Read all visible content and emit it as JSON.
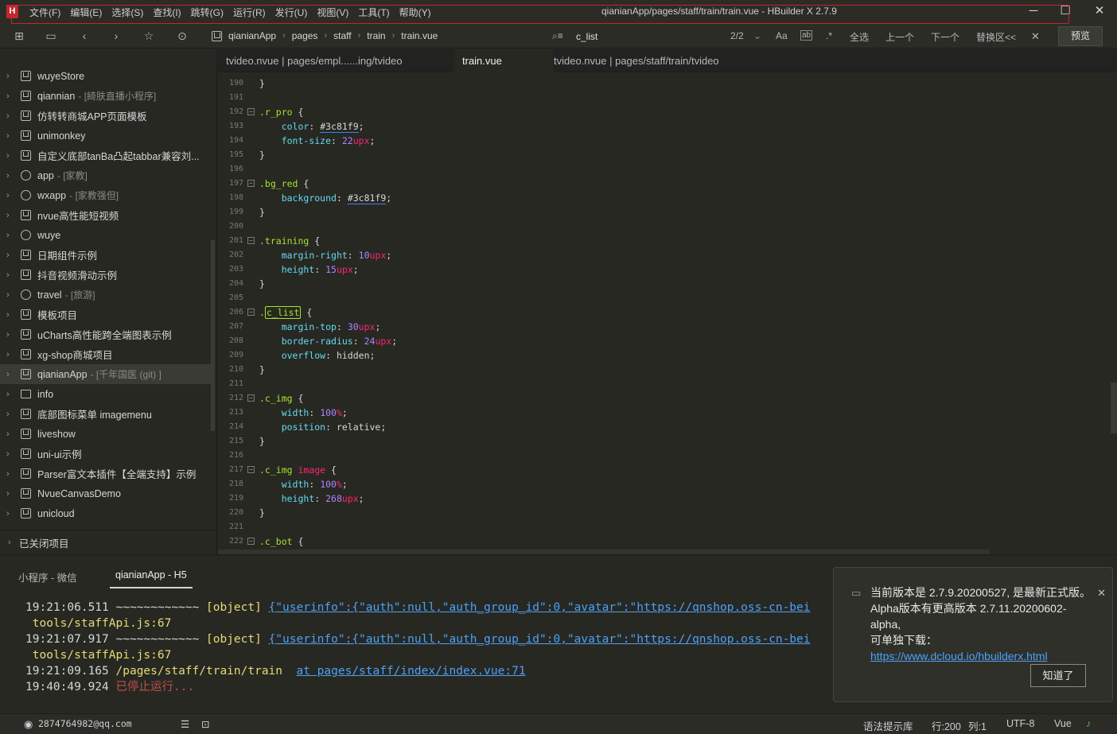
{
  "title_bar": {
    "logo": "H",
    "menus": [
      "文件(F)",
      "编辑(E)",
      "选择(S)",
      "查找(I)",
      "跳转(G)",
      "运行(R)",
      "发行(U)",
      "视图(V)",
      "工具(T)",
      "帮助(Y)"
    ],
    "window_title": "qianianApp/pages/staff/train/train.vue - HBuilder X 2.7.9"
  },
  "toolbar": {
    "breadcrumb": [
      "qianianApp",
      "pages",
      "staff",
      "train",
      "train.vue"
    ],
    "find_value": "c_list",
    "find_count": "2/2",
    "opt_case": "Aa",
    "opt_word": "ab",
    "opt_regex": ".*",
    "select_all": "全选",
    "prev": "上一个",
    "next": "下一个",
    "replace": "替换区<<",
    "preview": "预览"
  },
  "sidebar": {
    "projects": [
      {
        "name": "wuyeStore",
        "tag": "",
        "icon": "project"
      },
      {
        "name": "qiannian",
        "tag": "- [綺肤直播小程序]",
        "icon": "project"
      },
      {
        "name": "仿转转商城APP页面模板",
        "tag": "",
        "icon": "project"
      },
      {
        "name": "unimonkey",
        "tag": "",
        "icon": "project"
      },
      {
        "name": "自定义底部tanBa凸起tabbar兼容刘...",
        "tag": "",
        "icon": "project"
      },
      {
        "name": "app",
        "tag": "- [家教]",
        "icon": "circle"
      },
      {
        "name": "wxapp",
        "tag": "- [家教强但]",
        "icon": "circle"
      },
      {
        "name": "nvue高性能短视频",
        "tag": "",
        "icon": "project"
      },
      {
        "name": "wuye",
        "tag": "",
        "icon": "circle"
      },
      {
        "name": "日期组件示例",
        "tag": "",
        "icon": "project"
      },
      {
        "name": "抖音视频滑动示例",
        "tag": "",
        "icon": "project"
      },
      {
        "name": "travel",
        "tag": "- [旅游]",
        "icon": "circle"
      },
      {
        "name": "模板项目",
        "tag": "",
        "icon": "project"
      },
      {
        "name": "uCharts高性能跨全端图表示例",
        "tag": "",
        "icon": "project"
      },
      {
        "name": "xg-shop商城项目",
        "tag": "",
        "icon": "project"
      },
      {
        "name": "qianianApp",
        "tag": "- [千年国医 (git) ]",
        "icon": "project"
      },
      {
        "name": "info",
        "tag": "",
        "icon": "folder"
      },
      {
        "name": "底部图标菜单 imagemenu",
        "tag": "",
        "icon": "project"
      },
      {
        "name": "liveshow",
        "tag": "",
        "icon": "project"
      },
      {
        "name": "uni-ui示例",
        "tag": "",
        "icon": "project"
      },
      {
        "name": "Parser富文本插件【全端支持】示例",
        "tag": "",
        "icon": "project"
      },
      {
        "name": "NvueCanvasDemo",
        "tag": "",
        "icon": "project"
      },
      {
        "name": "unicloud",
        "tag": "",
        "icon": "project"
      }
    ],
    "selected_index": 15,
    "closed_projects": "已关闭项目"
  },
  "tabs": [
    {
      "label": "tvideo.nvue | pages/empl......ing/tvideo",
      "active": false
    },
    {
      "label": "train.vue",
      "active": true
    },
    {
      "label": "tvideo.nvue | pages/staff/train/tvideo",
      "active": false
    }
  ],
  "code_lines": [
    {
      "n": "190",
      "fold": false,
      "html": "}"
    },
    {
      "n": "191",
      "fold": false,
      "html": ""
    },
    {
      "n": "192",
      "fold": true,
      "html": "<span class='sel'>.r_pro</span> {"
    },
    {
      "n": "193",
      "fold": false,
      "html": "    <span class='prop'>color</span>: <span class='val hl'>#3c81f9</span>;"
    },
    {
      "n": "194",
      "fold": false,
      "html": "    <span class='prop'>font-size</span>: <span class='num'>22</span><span class='unit'>upx</span>;"
    },
    {
      "n": "195",
      "fold": false,
      "html": "}"
    },
    {
      "n": "196",
      "fold": false,
      "html": ""
    },
    {
      "n": "197",
      "fold": true,
      "html": "<span class='sel'>.bg_red</span> {"
    },
    {
      "n": "198",
      "fold": false,
      "html": "    <span class='prop'>background</span>: <span class='val hl'>#3c81f9</span>;"
    },
    {
      "n": "199",
      "fold": false,
      "html": "}"
    },
    {
      "n": "200",
      "fold": false,
      "html": ""
    },
    {
      "n": "201",
      "fold": true,
      "html": "<span class='sel'>.training</span> {"
    },
    {
      "n": "202",
      "fold": false,
      "html": "    <span class='prop'>margin-right</span>: <span class='num'>10</span><span class='unit'>upx</span>;"
    },
    {
      "n": "203",
      "fold": false,
      "html": "    <span class='prop'>height</span>: <span class='num'>15</span><span class='unit'>upx</span>;"
    },
    {
      "n": "204",
      "fold": false,
      "html": "}"
    },
    {
      "n": "205",
      "fold": false,
      "html": ""
    },
    {
      "n": "206",
      "fold": true,
      "html": "<span class='sel'>.<span class='box'>c_list</span></span> {"
    },
    {
      "n": "207",
      "fold": false,
      "html": "    <span class='prop'>margin-top</span>: <span class='num'>30</span><span class='unit'>upx</span>;"
    },
    {
      "n": "208",
      "fold": false,
      "html": "    <span class='prop'>border-radius</span>: <span class='num'>24</span><span class='unit'>upx</span>;"
    },
    {
      "n": "209",
      "fold": false,
      "html": "    <span class='prop'>overflow</span>: <span class='val'>hidden</span>;"
    },
    {
      "n": "210",
      "fold": false,
      "html": "}"
    },
    {
      "n": "211",
      "fold": false,
      "html": ""
    },
    {
      "n": "212",
      "fold": true,
      "html": "<span class='sel'>.c_img</span> {"
    },
    {
      "n": "213",
      "fold": false,
      "html": "    <span class='prop'>width</span>: <span class='num'>100</span><span class='unit'>%</span>;"
    },
    {
      "n": "214",
      "fold": false,
      "html": "    <span class='prop'>position</span>: <span class='val'>relative</span>;"
    },
    {
      "n": "215",
      "fold": false,
      "html": "}"
    },
    {
      "n": "216",
      "fold": false,
      "html": ""
    },
    {
      "n": "217",
      "fold": true,
      "html": "<span class='sel'>.c_img</span> <span class='unit'>image</span> {"
    },
    {
      "n": "218",
      "fold": false,
      "html": "    <span class='prop'>width</span>: <span class='num'>100</span><span class='unit'>%</span>;"
    },
    {
      "n": "219",
      "fold": false,
      "html": "    <span class='prop'>height</span>: <span class='num'>268</span><span class='unit'>upx</span>;"
    },
    {
      "n": "220",
      "fold": false,
      "html": "}"
    },
    {
      "n": "221",
      "fold": false,
      "html": ""
    },
    {
      "n": "222",
      "fold": true,
      "html": "<span class='sel'>.c_bot</span> {"
    }
  ],
  "console": {
    "tabs": [
      {
        "label": "小程序 - 微信",
        "active": false
      },
      {
        "label": "qianianApp - H5",
        "active": true
      }
    ],
    "lines": [
      {
        "html": "19:21:06.511 ~~~~~~~~~~~~ <span class='obj'>[object]</span> <span class='link'>{\"userinfo\":{\"auth\":null,\"auth_group_id\":0,\"avatar\":\"https://qnshop.oss-cn-bei</span>"
      },
      {
        "html": " <span class='path'>tools/staffApi.js:67</span>"
      },
      {
        "html": "19:21:07.917 ~~~~~~~~~~~~ <span class='obj'>[object]</span> <span class='link'>{\"userinfo\":{\"auth\":null,\"auth_group_id\":0,\"avatar\":\"https://qnshop.oss-cn-bei</span>"
      },
      {
        "html": " <span class='path'>tools/staffApi.js:67</span>"
      },
      {
        "html": "19:21:09.165 <span class='path'>/pages/staff/train/train</span>  <span class='link'>at pages/staff/index/index.vue:71</span>"
      },
      {
        "html": "19:40:49.924 <span class='stop'>已停止运行...</span>"
      }
    ]
  },
  "notification": {
    "line1": "当前版本是 2.7.9.20200527, 是最新正式版。",
    "line2": "Alpha版本有更高版本 2.7.11.20200602-alpha,",
    "line3": "可单独下载：",
    "link": "https://www.dcloud.io/hbuilderx.html",
    "button": "知道了"
  },
  "status_bar": {
    "user": "2874764982@qq.com",
    "syntax_hint": "语法提示库",
    "line": "行:200",
    "col": "列:1",
    "encoding": "UTF-8",
    "language": "Vue"
  },
  "colors": {
    "accent": "#c0272d",
    "link": "#4ea0f7",
    "editor_bg": "#272822"
  }
}
